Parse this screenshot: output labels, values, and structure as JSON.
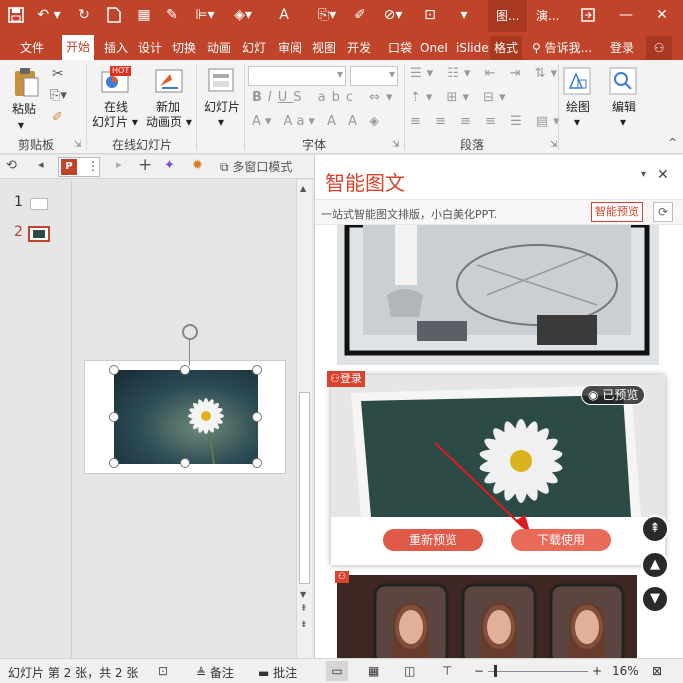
{
  "titlebar": {
    "context_tab_1": "图...",
    "context_tab_2": "演..."
  },
  "tabs": [
    "文件",
    "开始",
    "插入",
    "设计",
    "切换",
    "动画",
    "幻灯",
    "审阅",
    "视图",
    "开发",
    "口袋",
    "OneI",
    "iSlide",
    "格式"
  ],
  "tell_me": "告诉我...",
  "login": "登录",
  "ribbon": {
    "paste": "粘贴",
    "online_slides_1": "在线",
    "online_slides_2": "幻灯片",
    "new_anim_1": "新加",
    "new_anim_2": "动画页",
    "hot_badge": "HOT",
    "slide": "幻灯片",
    "draw": "绘图",
    "edit": "编辑",
    "groups": {
      "clipboard": "剪贴板",
      "online": "在线幻灯片",
      "font": "字体",
      "paragraph": "段落"
    }
  },
  "subbar": {
    "multi_window": "多窗口模式"
  },
  "thumbs": [
    {
      "num": "1"
    },
    {
      "num": "2"
    }
  ],
  "pane": {
    "title": "智能图文",
    "subtitle": "一站式智能图文排版，小白美化PPT.",
    "preview_button": "智能预览",
    "login_tag": "登录",
    "previewed": "已预览",
    "repreview": "重新预览",
    "download": "下载使用"
  },
  "status": {
    "slide_info": "幻灯片 第 2 张，共 2 张",
    "notes": "备注",
    "comments": "批注",
    "zoom": "16%"
  },
  "colors": {
    "accent": "#c0442a",
    "button": "#e05a4a"
  }
}
